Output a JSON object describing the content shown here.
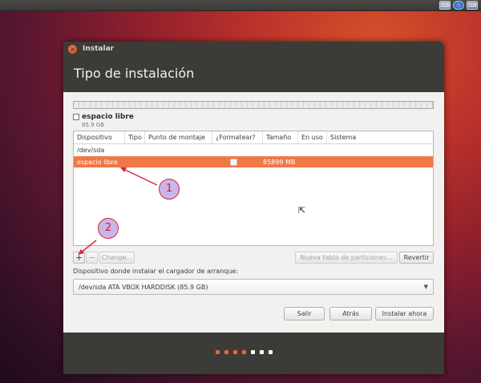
{
  "tray": {
    "keyboard_icon": "keyboard-icon",
    "accessibility_icon": "accessibility-icon"
  },
  "window": {
    "title": "Instalar",
    "close_icon": "close-icon"
  },
  "header": {
    "title": "Tipo de instalación"
  },
  "legend": {
    "name": "espacio libre",
    "size": "85.9 GB"
  },
  "table": {
    "columns": [
      "Dispositivo",
      "Tipo",
      "Punto de montaje",
      "¿Formatear?",
      "Tamaño",
      "En uso",
      "Sistema"
    ],
    "rows": [
      {
        "device": "/dev/sda",
        "type": "",
        "mount": "",
        "format": "",
        "size": "",
        "used": "",
        "system": "",
        "selected": false
      },
      {
        "device": "espacio libre",
        "type": "",
        "mount": "",
        "format": "checkbox",
        "size": "85899 MB",
        "used": "",
        "system": "",
        "selected": true
      }
    ]
  },
  "toolbar": {
    "add_label": "+",
    "remove_label": "−",
    "change_label": "Change...",
    "new_table_label": "Nueva tabla de particiones...",
    "revert_label": "Revertir"
  },
  "bootloader": {
    "label": "Dispositivo donde instalar el cargador de arranque:",
    "selected": "/dev/sda  ATA VBOX HARDDISK (85.9 GB)"
  },
  "actions": {
    "quit": "Salir",
    "back": "Atrás",
    "install": "Instalar ahora"
  },
  "progress": {
    "total_steps": 7,
    "current_step": 4,
    "color_done": "#e9643b",
    "color_todo": "#ffffff"
  },
  "annotations": {
    "one": "1",
    "two": "2"
  },
  "colors": {
    "accent": "#f07746",
    "chrome": "#3c3b37"
  }
}
